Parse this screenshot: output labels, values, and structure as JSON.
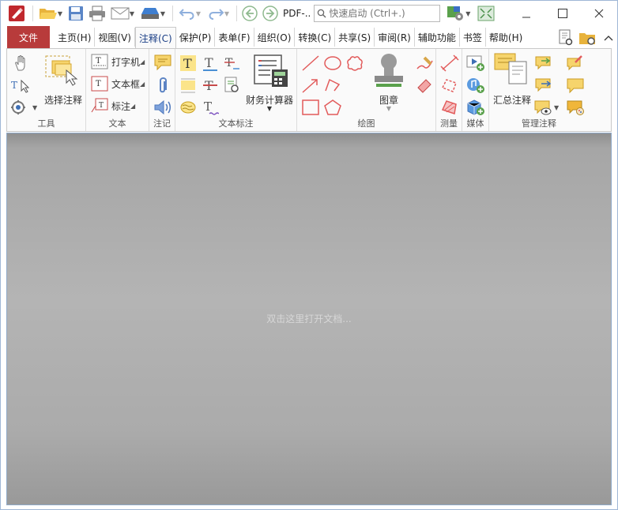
{
  "titlebar": {
    "doc_title": "PDF-..",
    "quick_launch_placeholder": "快速启动 (Ctrl+.)"
  },
  "menu": {
    "file": "文件",
    "tabs": [
      "主页(H)",
      "视图(V)",
      "注释(C)",
      "保护(P)",
      "表单(F)",
      "组织(O)",
      "转换(C)",
      "共享(S)",
      "审阅(R)",
      "辅助功能",
      "书签",
      "帮助(H)"
    ],
    "active_tab": "注释(C)"
  },
  "ribbon": {
    "tools_group": "工具",
    "select_comment": "选择注释",
    "text_group": "文本",
    "typewriter": "打字机",
    "textbox": "文本框",
    "callout": "标注",
    "note_group": "注记",
    "text_markup_group": "文本标注",
    "financial_calculator": "财务计算器",
    "drawing_group": "绘图",
    "stamp": "图章",
    "measure_group": "测量",
    "media_group": "媒体",
    "manage_group": "管理注释",
    "summarize_comments": "汇总注释"
  },
  "document": {
    "hint": "双击这里打开文档..."
  },
  "colors": {
    "accent_red": "#b83b3b",
    "draw_red": "#e25b5b",
    "note_yellow": "#f3c84c"
  }
}
